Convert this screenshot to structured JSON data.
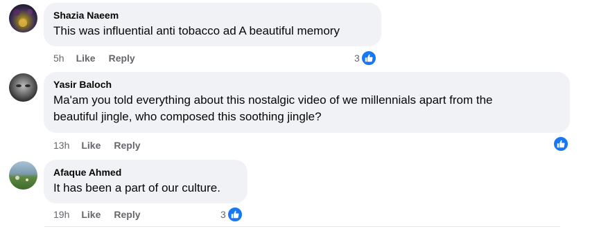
{
  "comments": [
    {
      "author": "Shazia Naeem",
      "text": "This was influential anti tobacco ad A beautiful memory",
      "time": "5h",
      "like_label": "Like",
      "reply_label": "Reply",
      "reaction_count": "3",
      "reaction_icon": "thumbs-up-icon",
      "avatar_colors": [
        "#3a2f4d",
        "#b58d2a"
      ]
    },
    {
      "author": "Yasir Baloch",
      "text_line1": "Ma'am you told everything about this nostalgic video of we millennials apart from the",
      "text_line2": "beautiful jingle, who composed this soothing jingle?",
      "time": "13h",
      "like_label": "Like",
      "reply_label": "Reply",
      "reaction_count": "",
      "reaction_icon": "thumbs-up-icon",
      "avatar_colors": [
        "#2b2b2b",
        "#9c9c9c"
      ]
    },
    {
      "author": "Afaque Ahmed",
      "text": "It has been a part of our culture.",
      "time": "19h",
      "like_label": "Like",
      "reply_label": "Reply",
      "reaction_count": "3",
      "reaction_icon": "thumbs-up-icon",
      "avatar_colors": [
        "#6f8fa8",
        "#4f7a3a"
      ]
    }
  ],
  "colors": {
    "bubble": "#f0f2f5",
    "meta_text": "#65676b",
    "reaction_blue": "#1877f2"
  }
}
